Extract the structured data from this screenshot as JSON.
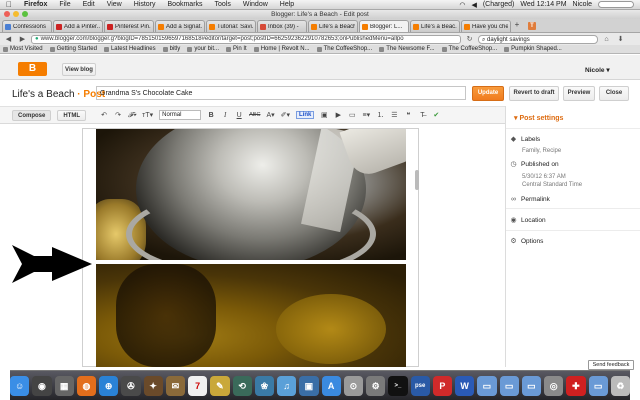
{
  "menubar": {
    "apple": "",
    "items": [
      "Firefox",
      "File",
      "Edit",
      "View",
      "History",
      "Bookmarks",
      "Tools",
      "Window",
      "Help"
    ],
    "battery": "(Charged)",
    "day_time": "Wed 12:14 PM",
    "user": "Nicole"
  },
  "window": {
    "title": "Blogger: Life's a Beach - Edit post"
  },
  "tabs": [
    {
      "label": "Confessions",
      "color": "#4a7fd4"
    },
    {
      "label": "Add a Pinter...",
      "color": "#cc2222"
    },
    {
      "label": "Pinterest Pin...",
      "color": "#cc2222"
    },
    {
      "label": "Add a Signat...",
      "color": "#f57d00"
    },
    {
      "label": "Tutorial: Savi...",
      "color": "#f57d00"
    },
    {
      "label": "Inbox (39) -",
      "color": "#d64937"
    },
    {
      "label": "Life's a Beach",
      "color": "#f57d00"
    },
    {
      "label": "Blogger: L...",
      "color": "#f57d00",
      "active": true
    },
    {
      "label": "Life's a Beac...",
      "color": "#f57d00"
    },
    {
      "label": "Have you che...",
      "color": "#f57d00"
    }
  ],
  "tab_extra": "T",
  "url": "www.blogger.com/blogger.g?blogID=7851501596597168518#editor/target=post;postID=6625923622910782653;onPublishedMenu=allpo",
  "search_text": "daylight savings",
  "bookmarks": [
    "Most Visited",
    "Getting Started",
    "Latest Headlines",
    "bitly",
    "your bit...",
    "Pin It",
    "Home | Revolt N...",
    "The CoffeeShop...",
    "The Newsome F...",
    "The CoffeeShop...",
    "Pumpkin Shaped..."
  ],
  "blogger": {
    "logo": "B",
    "view_blog": "View blog",
    "user": "Nicole",
    "blog_title": "Life's a Beach",
    "separator": "·",
    "section": "Post",
    "post_title": "Grandma S's Chocolate Cake",
    "buttons": {
      "update": "Update",
      "revert": "Revert to draft",
      "preview": "Preview",
      "close": "Close"
    }
  },
  "toolbar": {
    "compose": "Compose",
    "html": "HTML",
    "font_size": "Normal",
    "bold": "B",
    "italic": "I",
    "underline": "U",
    "strike": "ABC",
    "link": "Link"
  },
  "sidebar": {
    "heading": "Post settings",
    "labels": {
      "title": "Labels",
      "value": "Family, Recipe"
    },
    "published": {
      "title": "Published on",
      "date": "5/30/12 6:37 AM",
      "tz": "Central Standard Time"
    },
    "permalink": "Permalink",
    "location": "Location",
    "options": "Options"
  },
  "send_feedback": "Send feedback",
  "dock": [
    {
      "icon": "finder-icon",
      "color": "#3a8ee6",
      "glyph": "☺"
    },
    {
      "icon": "dashboard-icon",
      "color": "#444",
      "glyph": "◉"
    },
    {
      "icon": "mission-control-icon",
      "color": "#666",
      "glyph": "▦"
    },
    {
      "icon": "firefox-icon",
      "color": "#e36e1c",
      "glyph": "◍"
    },
    {
      "icon": "safari-icon",
      "color": "#2a82d6",
      "glyph": "⊕"
    },
    {
      "icon": "facetime-icon",
      "color": "#4a4a4a",
      "glyph": "✇"
    },
    {
      "icon": "photo-icon",
      "color": "#6a4a2a",
      "glyph": "✦"
    },
    {
      "icon": "stamps-icon",
      "color": "#8a6a3a",
      "glyph": "✉"
    },
    {
      "icon": "calendar-icon",
      "color": "#f0f0f0",
      "glyph": "7"
    },
    {
      "icon": "notes-icon",
      "color": "#c9a83a",
      "glyph": "✎"
    },
    {
      "icon": "time-machine-icon",
      "color": "#3a6a5a",
      "glyph": "⟲"
    },
    {
      "icon": "photos-icon",
      "color": "#3a7aa6",
      "glyph": "❀"
    },
    {
      "icon": "itunes-icon",
      "color": "#5aa0d8",
      "glyph": "♫"
    },
    {
      "icon": "iphoto-icon",
      "color": "#3a6ea6",
      "glyph": "▣"
    },
    {
      "icon": "app-store-icon",
      "color": "#3a8ae0",
      "glyph": "A"
    },
    {
      "icon": "preview-icon",
      "color": "#9a9a9a",
      "glyph": "⊙"
    },
    {
      "icon": "system-prefs-icon",
      "color": "#7a7a7a",
      "glyph": "⚙"
    },
    {
      "icon": "terminal-icon",
      "color": "#111",
      "glyph": ">_"
    },
    {
      "icon": "photoshop-elements-icon",
      "color": "#2a5aa6",
      "glyph": "pse"
    },
    {
      "icon": "pdf-icon",
      "color": "#d02a2a",
      "glyph": "P"
    },
    {
      "icon": "word-icon",
      "color": "#2a5ab6",
      "glyph": "W"
    },
    {
      "icon": "folder-icon",
      "color": "#6a9ad6",
      "glyph": "▭"
    },
    {
      "icon": "folder2-icon",
      "color": "#6a9ad6",
      "glyph": "▭"
    },
    {
      "icon": "folder3-icon",
      "color": "#6a9ad6",
      "glyph": "▭"
    },
    {
      "icon": "camera-icon",
      "color": "#8a8a8a",
      "glyph": "◎"
    },
    {
      "icon": "flag-icon",
      "color": "#d02020",
      "glyph": "✚"
    },
    {
      "icon": "folder4-icon",
      "color": "#6a9ad6",
      "glyph": "▭"
    },
    {
      "icon": "trash-icon",
      "color": "#bbb",
      "glyph": "♻"
    }
  ]
}
